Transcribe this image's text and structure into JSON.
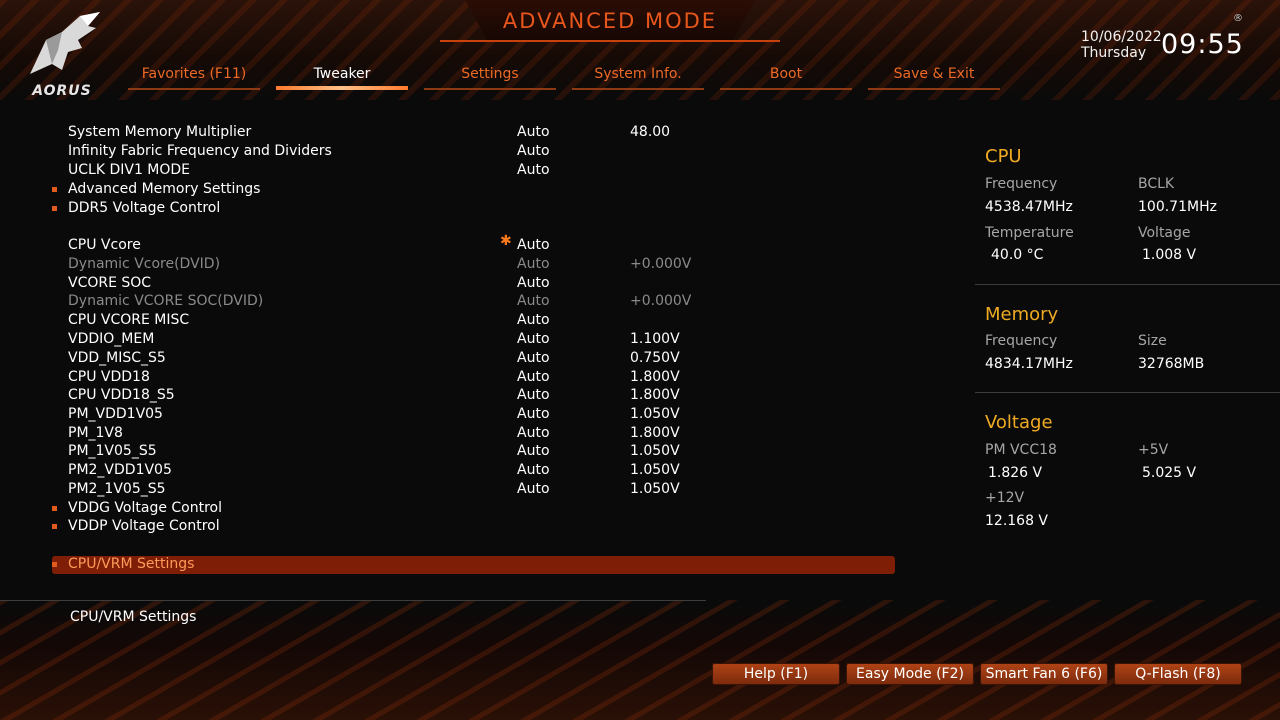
{
  "brand": "AORUS",
  "page_title": "ADVANCED MODE",
  "clock": {
    "date": "10/06/2022",
    "weekday": "Thursday",
    "time": "09:55",
    "reg_mark": "®"
  },
  "tabs": [
    {
      "label": "Favorites (F11)",
      "active": false
    },
    {
      "label": "Tweaker",
      "active": true
    },
    {
      "label": "Settings",
      "active": false
    },
    {
      "label": "System Info.",
      "active": false
    },
    {
      "label": "Boot",
      "active": false
    },
    {
      "label": "Save & Exit",
      "active": false
    }
  ],
  "settings": [
    {
      "label": "System Memory Multiplier",
      "mode": "Auto",
      "value": "48.00"
    },
    {
      "label": "Infinity Fabric Frequency and Dividers",
      "mode": "Auto",
      "value": ""
    },
    {
      "label": "UCLK DIV1 MODE",
      "mode": "Auto",
      "value": ""
    },
    {
      "label": "Advanced Memory Settings",
      "mode": "",
      "value": "",
      "submenu": true
    },
    {
      "label": "DDR5 Voltage Control",
      "mode": "",
      "value": "",
      "submenu": true
    },
    {
      "label": "CPU Vcore",
      "mode": "Auto",
      "value": "",
      "modified": true
    },
    {
      "label": "Dynamic Vcore(DVID)",
      "mode": "Auto",
      "value": "+0.000V",
      "disabled": true
    },
    {
      "label": "VCORE SOC",
      "mode": "Auto",
      "value": ""
    },
    {
      "label": "Dynamic VCORE SOC(DVID)",
      "mode": "Auto",
      "value": "+0.000V",
      "disabled": true
    },
    {
      "label": "CPU VCORE MISC",
      "mode": "Auto",
      "value": ""
    },
    {
      "label": "VDDIO_MEM",
      "mode": "Auto",
      "value": "1.100V"
    },
    {
      "label": "VDD_MISC_S5",
      "mode": "Auto",
      "value": "0.750V"
    },
    {
      "label": "CPU VDD18",
      "mode": "Auto",
      "value": "1.800V"
    },
    {
      "label": "CPU VDD18_S5",
      "mode": "Auto",
      "value": "1.800V"
    },
    {
      "label": "PM_VDD1V05",
      "mode": "Auto",
      "value": "1.050V"
    },
    {
      "label": "PM_1V8",
      "mode": "Auto",
      "value": "1.800V"
    },
    {
      "label": "PM_1V05_S5",
      "mode": "Auto",
      "value": "1.050V"
    },
    {
      "label": "PM2_VDD1V05",
      "mode": "Auto",
      "value": "1.050V"
    },
    {
      "label": "PM2_1V05_S5",
      "mode": "Auto",
      "value": "1.050V"
    },
    {
      "label": "VDDG Voltage Control",
      "mode": "",
      "value": "",
      "submenu": true
    },
    {
      "label": "VDDP Voltage Control",
      "mode": "",
      "value": "",
      "submenu": true
    },
    {
      "label": "CPU/VRM Settings",
      "mode": "",
      "value": "",
      "submenu": true,
      "selected": true
    }
  ],
  "help_text": "CPU/VRM Settings",
  "info": {
    "cpu": {
      "heading": "CPU",
      "frequency_label": "Frequency",
      "frequency": "4538.47MHz",
      "bclk_label": "BCLK",
      "bclk": "100.71MHz",
      "temperature_label": "Temperature",
      "temperature": "40.0 °C",
      "voltage_label": "Voltage",
      "voltage": "1.008 V"
    },
    "memory": {
      "heading": "Memory",
      "frequency_label": "Frequency",
      "frequency": "4834.17MHz",
      "size_label": "Size",
      "size": "32768MB"
    },
    "voltage": {
      "heading": "Voltage",
      "pmvcc18_label": "PM VCC18",
      "pmvcc18": "1.826 V",
      "v5_label": "+5V",
      "v5": "5.025 V",
      "v12_label": "+12V",
      "v12": "12.168 V"
    }
  },
  "buttons": {
    "help": "Help (F1)",
    "easy_mode": "Easy Mode (F2)",
    "smart_fan": "Smart Fan 6 (F6)",
    "qflash": "Q-Flash (F8)"
  },
  "colors": {
    "accent": "#e8561c",
    "heading": "#f0ab22",
    "selection": "#7f1e06"
  }
}
